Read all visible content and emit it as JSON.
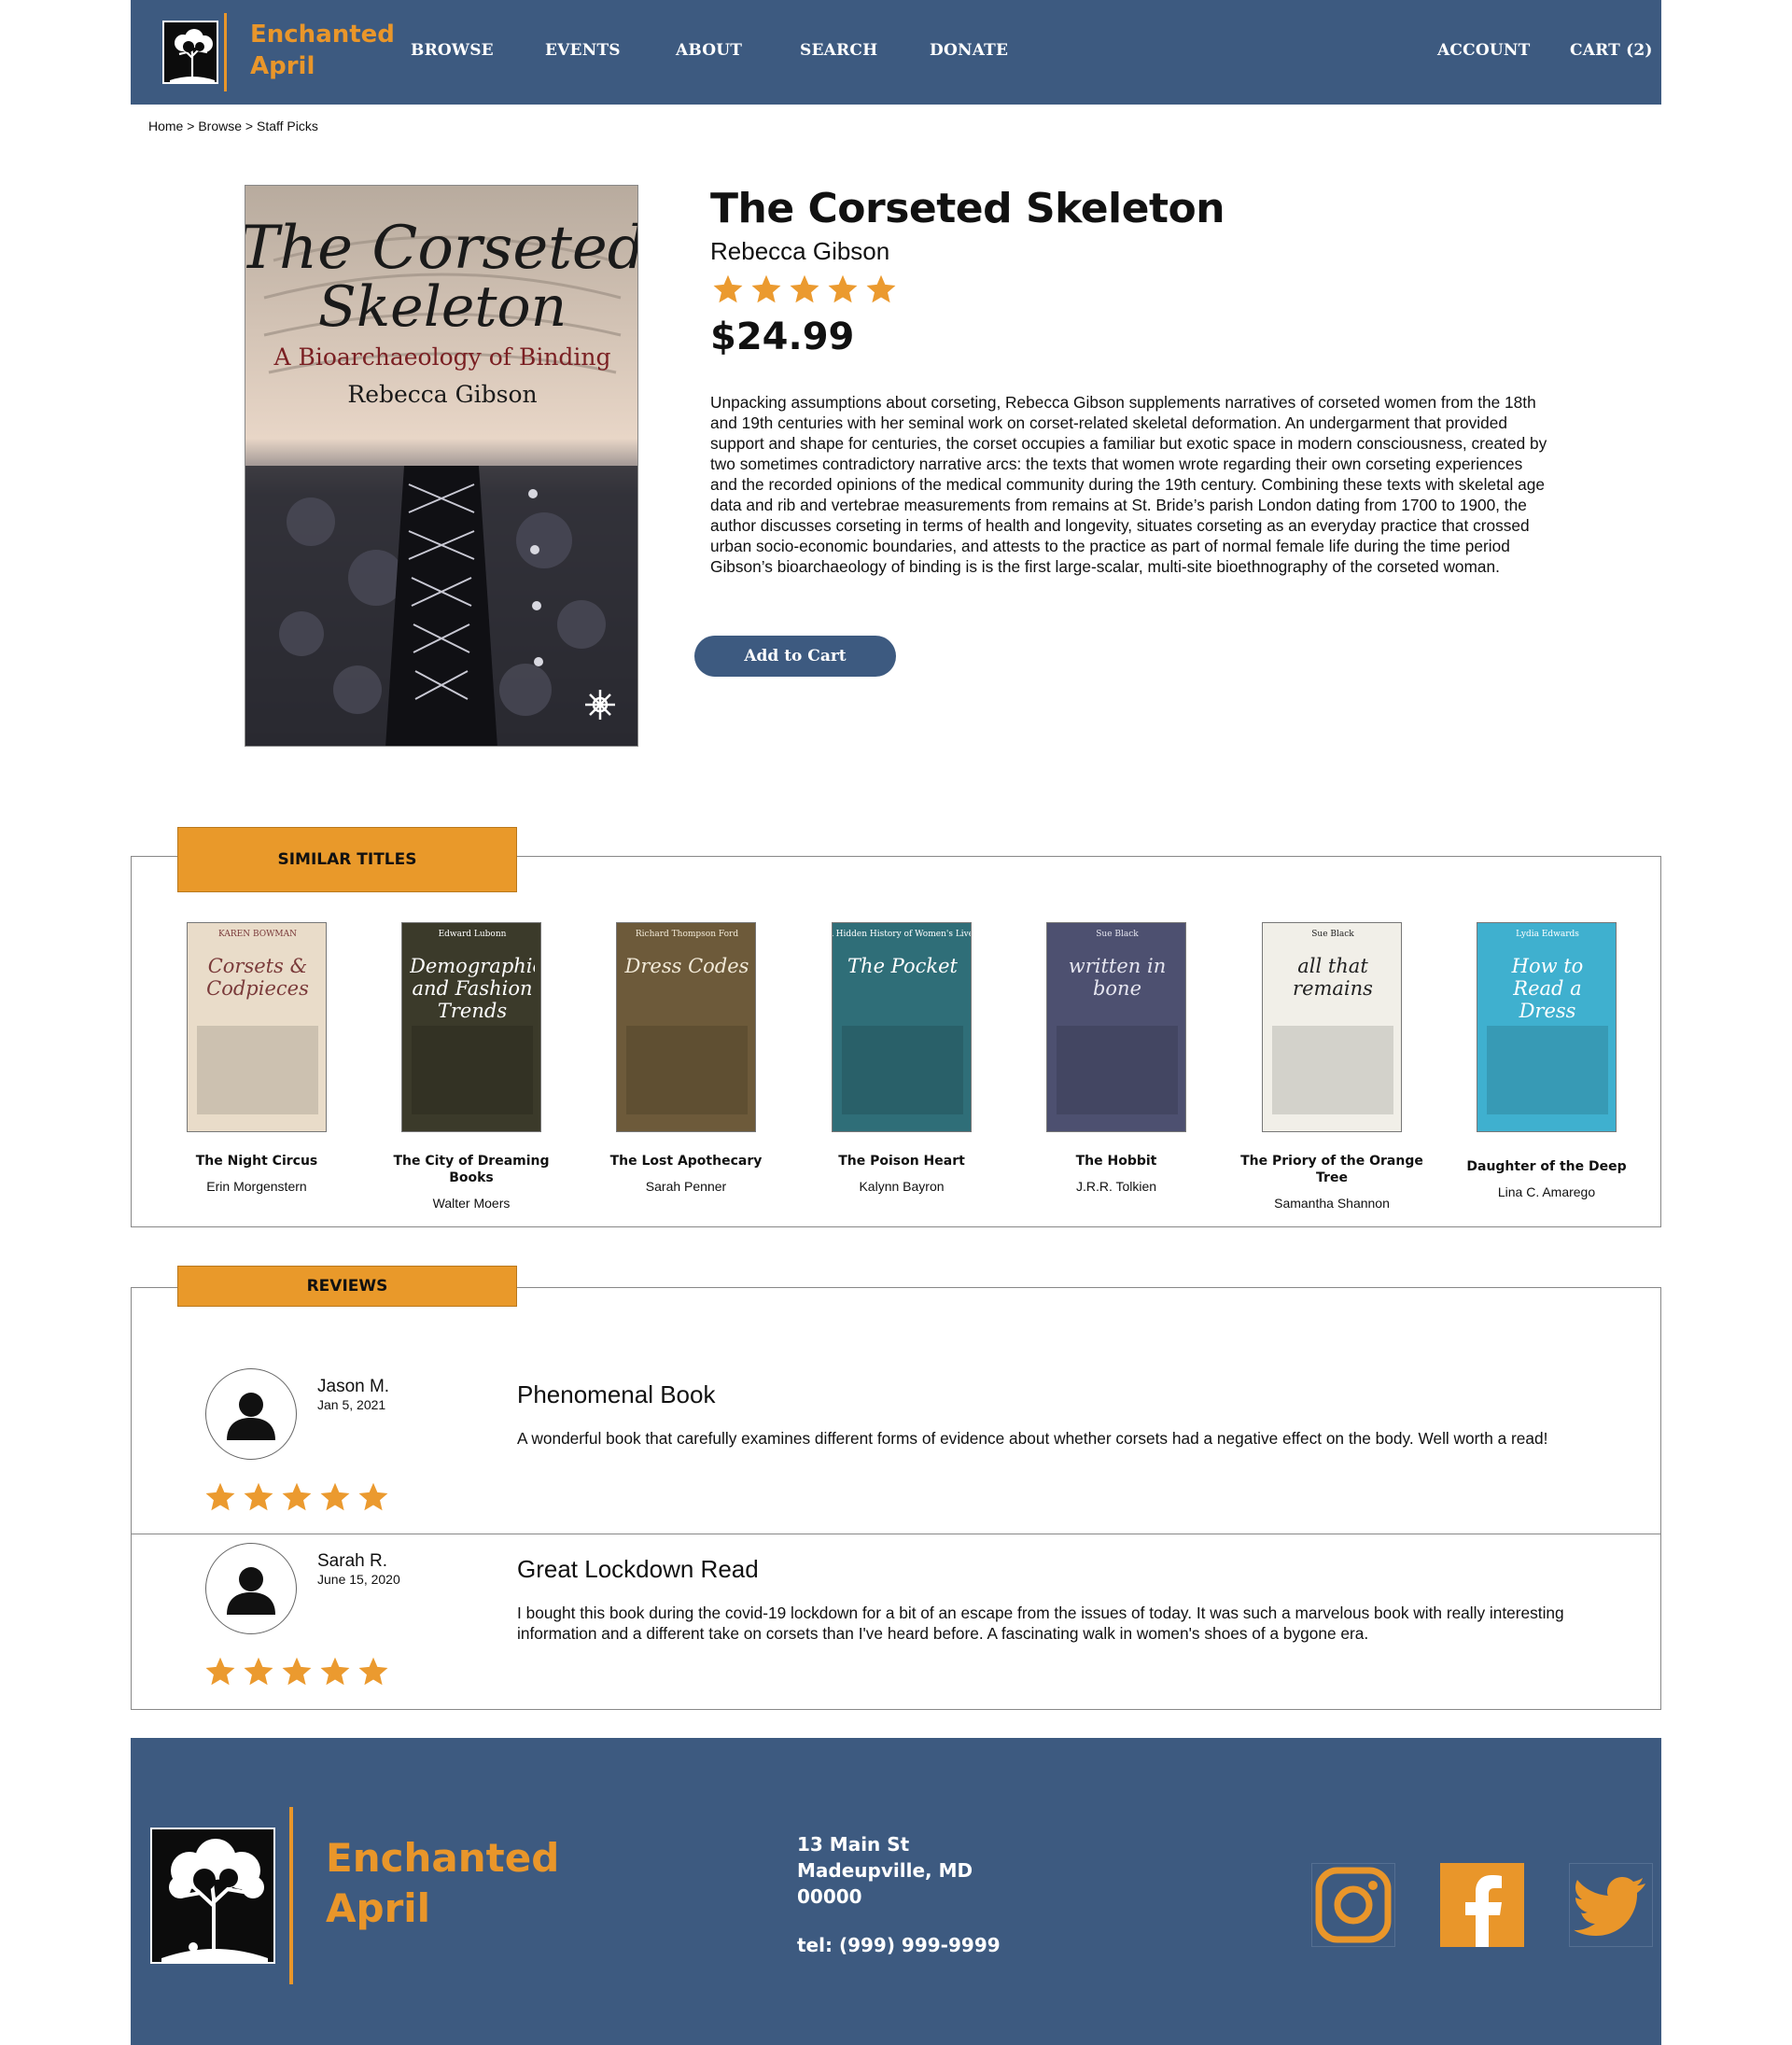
{
  "brand": {
    "name_line1": "Enchanted",
    "name_line2": "April"
  },
  "nav": {
    "browse": "BROWSE",
    "events": "EVENTS",
    "about": "ABOUT",
    "search": "SEARCH",
    "donate": "DONATE",
    "account": "ACCOUNT",
    "cart": "CART (2)"
  },
  "breadcrumb": {
    "home": "Home",
    "browse": "Browse",
    "current": "Staff Picks",
    "separator": ">"
  },
  "product": {
    "cover_title_line1": "The Corseted",
    "cover_title_line2": "Skeleton",
    "cover_subtitle": "A Bioarchaeology of Binding",
    "cover_author": "Rebecca Gibson",
    "title": "The Corseted Skeleton",
    "author": "Rebecca Gibson",
    "rating": 5,
    "price": "$24.99",
    "description": "Unpacking assumptions about corseting, Rebecca Gibson supplements narratives of corseted women from the 18th and 19th centuries with her seminal work on corset-related skeletal deformation. An undergarment that provided support and shape for centuries, the corset occupies a familiar but exotic space in modern consciousness, created by two sometimes contradictory narrative arcs: the texts that women wrote regarding their own corseting experiences and the recorded opinions of the medical community during the 19th century. Combining these texts with skeletal age data and rib and vertebrae measurements from remains at St. Bride’s parish London dating from 1700 to 1900, the author discusses corseting in terms of health and longevity, situates corseting as an everyday practice that crossed urban socio-economic boundaries, and attests to the practice as part of normal female life during the time period Gibson’s bioarchaeology of binding is is the first large-scalar, multi-site bioethnography of the corseted woman.",
    "add_to_cart": "Add to Cart"
  },
  "similar": {
    "heading": "SIMILAR TITLES",
    "books": [
      {
        "title": "The Night Circus",
        "author": "Erin Morgenstern",
        "cover_text": "Corsets & Codpieces",
        "cover_top": "KAREN BOWMAN",
        "bg": "#e9dcc9",
        "fg": "#7a3a3a"
      },
      {
        "title": "The City of Dreaming Books",
        "author": "Walter Moers",
        "cover_text": "Demographics and Fashion Trends",
        "cover_top": "Edward Lubonn",
        "bg": "#3b3a2a",
        "fg": "#ffffff"
      },
      {
        "title": "The Lost Apothecary",
        "author": "Sarah Penner",
        "cover_text": "Dress Codes",
        "cover_top": "Richard Thompson Ford",
        "bg": "#6d5a3a",
        "fg": "#f2ead8"
      },
      {
        "title": "The Poison Heart",
        "author": "Kalynn Bayron",
        "cover_text": "The Pocket",
        "cover_top": "A Hidden History of Women's Lives",
        "bg": "#2f6e78",
        "fg": "#ffffff"
      },
      {
        "title": "The Hobbit",
        "author": "J.R.R. Tolkien",
        "cover_text": "written in bone",
        "cover_top": "Sue Black",
        "bg": "#4d5070",
        "fg": "#e6e6f0"
      },
      {
        "title": "The Priory of the Orange Tree",
        "author": "Samantha Shannon",
        "cover_text": "all that remains",
        "cover_top": "Sue Black",
        "bg": "#f1efe8",
        "fg": "#222222"
      },
      {
        "title": "Daughter of the Deep",
        "author": "Lina C. Amarego",
        "cover_text": "How to Read a Dress",
        "cover_top": "Lydia Edwards",
        "bg": "#3fb0cf",
        "fg": "#ffffff"
      }
    ]
  },
  "reviews": {
    "heading": "REVIEWS",
    "items": [
      {
        "name": "Jason M.",
        "date": "Jan 5, 2021",
        "rating": 5,
        "headline": "Phenomenal Book",
        "body": "A wonderful book that carefully examines different forms of evidence about whether corsets had a negative effect on the body.  Well worth a read!"
      },
      {
        "name": "Sarah R.",
        "date": "June 15, 2020",
        "rating": 5,
        "headline": "Great Lockdown Read",
        "body": "I bought this book during the covid-19 lockdown for a bit of an escape from the issues of today.  It was such a marvelous book with really interesting information and a different take on corsets than I've heard before. A fascinating walk in women's shoes of a bygone era."
      }
    ]
  },
  "footer": {
    "address_line1": "13 Main St",
    "address_line2": "Madeupville, MD",
    "address_line3": "00000",
    "phone": "tel: (999) 999-9999",
    "social": [
      "instagram-icon",
      "facebook-icon",
      "twitter-icon"
    ]
  },
  "colors": {
    "primary": "#3d5a80",
    "accent": "#e9962a",
    "star": "#eb9a2f"
  }
}
